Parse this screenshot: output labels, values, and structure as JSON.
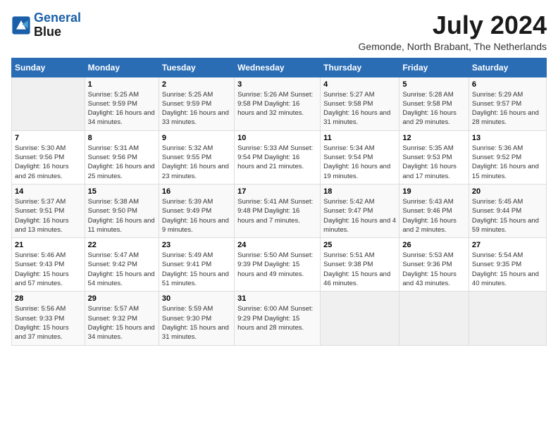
{
  "header": {
    "logo_line1": "General",
    "logo_line2": "Blue",
    "month_year": "July 2024",
    "location": "Gemonde, North Brabant, The Netherlands"
  },
  "days_of_week": [
    "Sunday",
    "Monday",
    "Tuesday",
    "Wednesday",
    "Thursday",
    "Friday",
    "Saturday"
  ],
  "weeks": [
    [
      {
        "day": "",
        "info": ""
      },
      {
        "day": "1",
        "info": "Sunrise: 5:25 AM\nSunset: 9:59 PM\nDaylight: 16 hours\nand 34 minutes."
      },
      {
        "day": "2",
        "info": "Sunrise: 5:25 AM\nSunset: 9:59 PM\nDaylight: 16 hours\nand 33 minutes."
      },
      {
        "day": "3",
        "info": "Sunrise: 5:26 AM\nSunset: 9:58 PM\nDaylight: 16 hours\nand 32 minutes."
      },
      {
        "day": "4",
        "info": "Sunrise: 5:27 AM\nSunset: 9:58 PM\nDaylight: 16 hours\nand 31 minutes."
      },
      {
        "day": "5",
        "info": "Sunrise: 5:28 AM\nSunset: 9:58 PM\nDaylight: 16 hours\nand 29 minutes."
      },
      {
        "day": "6",
        "info": "Sunrise: 5:29 AM\nSunset: 9:57 PM\nDaylight: 16 hours\nand 28 minutes."
      }
    ],
    [
      {
        "day": "7",
        "info": "Sunrise: 5:30 AM\nSunset: 9:56 PM\nDaylight: 16 hours\nand 26 minutes."
      },
      {
        "day": "8",
        "info": "Sunrise: 5:31 AM\nSunset: 9:56 PM\nDaylight: 16 hours\nand 25 minutes."
      },
      {
        "day": "9",
        "info": "Sunrise: 5:32 AM\nSunset: 9:55 PM\nDaylight: 16 hours\nand 23 minutes."
      },
      {
        "day": "10",
        "info": "Sunrise: 5:33 AM\nSunset: 9:54 PM\nDaylight: 16 hours\nand 21 minutes."
      },
      {
        "day": "11",
        "info": "Sunrise: 5:34 AM\nSunset: 9:54 PM\nDaylight: 16 hours\nand 19 minutes."
      },
      {
        "day": "12",
        "info": "Sunrise: 5:35 AM\nSunset: 9:53 PM\nDaylight: 16 hours\nand 17 minutes."
      },
      {
        "day": "13",
        "info": "Sunrise: 5:36 AM\nSunset: 9:52 PM\nDaylight: 16 hours\nand 15 minutes."
      }
    ],
    [
      {
        "day": "14",
        "info": "Sunrise: 5:37 AM\nSunset: 9:51 PM\nDaylight: 16 hours\nand 13 minutes."
      },
      {
        "day": "15",
        "info": "Sunrise: 5:38 AM\nSunset: 9:50 PM\nDaylight: 16 hours\nand 11 minutes."
      },
      {
        "day": "16",
        "info": "Sunrise: 5:39 AM\nSunset: 9:49 PM\nDaylight: 16 hours\nand 9 minutes."
      },
      {
        "day": "17",
        "info": "Sunrise: 5:41 AM\nSunset: 9:48 PM\nDaylight: 16 hours\nand 7 minutes."
      },
      {
        "day": "18",
        "info": "Sunrise: 5:42 AM\nSunset: 9:47 PM\nDaylight: 16 hours\nand 4 minutes."
      },
      {
        "day": "19",
        "info": "Sunrise: 5:43 AM\nSunset: 9:46 PM\nDaylight: 16 hours\nand 2 minutes."
      },
      {
        "day": "20",
        "info": "Sunrise: 5:45 AM\nSunset: 9:44 PM\nDaylight: 15 hours\nand 59 minutes."
      }
    ],
    [
      {
        "day": "21",
        "info": "Sunrise: 5:46 AM\nSunset: 9:43 PM\nDaylight: 15 hours\nand 57 minutes."
      },
      {
        "day": "22",
        "info": "Sunrise: 5:47 AM\nSunset: 9:42 PM\nDaylight: 15 hours\nand 54 minutes."
      },
      {
        "day": "23",
        "info": "Sunrise: 5:49 AM\nSunset: 9:41 PM\nDaylight: 15 hours\nand 51 minutes."
      },
      {
        "day": "24",
        "info": "Sunrise: 5:50 AM\nSunset: 9:39 PM\nDaylight: 15 hours\nand 49 minutes."
      },
      {
        "day": "25",
        "info": "Sunrise: 5:51 AM\nSunset: 9:38 PM\nDaylight: 15 hours\nand 46 minutes."
      },
      {
        "day": "26",
        "info": "Sunrise: 5:53 AM\nSunset: 9:36 PM\nDaylight: 15 hours\nand 43 minutes."
      },
      {
        "day": "27",
        "info": "Sunrise: 5:54 AM\nSunset: 9:35 PM\nDaylight: 15 hours\nand 40 minutes."
      }
    ],
    [
      {
        "day": "28",
        "info": "Sunrise: 5:56 AM\nSunset: 9:33 PM\nDaylight: 15 hours\nand 37 minutes."
      },
      {
        "day": "29",
        "info": "Sunrise: 5:57 AM\nSunset: 9:32 PM\nDaylight: 15 hours\nand 34 minutes."
      },
      {
        "day": "30",
        "info": "Sunrise: 5:59 AM\nSunset: 9:30 PM\nDaylight: 15 hours\nand 31 minutes."
      },
      {
        "day": "31",
        "info": "Sunrise: 6:00 AM\nSunset: 9:29 PM\nDaylight: 15 hours\nand 28 minutes."
      },
      {
        "day": "",
        "info": ""
      },
      {
        "day": "",
        "info": ""
      },
      {
        "day": "",
        "info": ""
      }
    ]
  ]
}
